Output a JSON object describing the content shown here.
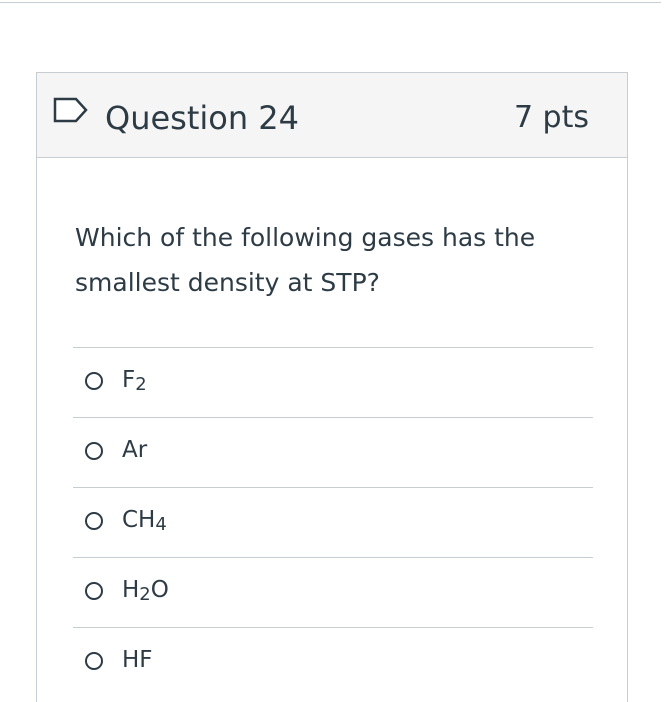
{
  "question": {
    "title": "Question 24",
    "points": "7 pts",
    "text": "Which of the following gases has the smallest density at STP?",
    "flag_icon": "flag-outline-icon"
  },
  "answers": [
    {
      "label": "F2"
    },
    {
      "label": "Ar"
    },
    {
      "label": "CH4"
    },
    {
      "label": "H2O"
    },
    {
      "label": "HF"
    }
  ],
  "colors": {
    "text": "#2d3b45",
    "header_bg": "#f5f5f5",
    "border": "#c7cdd1"
  }
}
